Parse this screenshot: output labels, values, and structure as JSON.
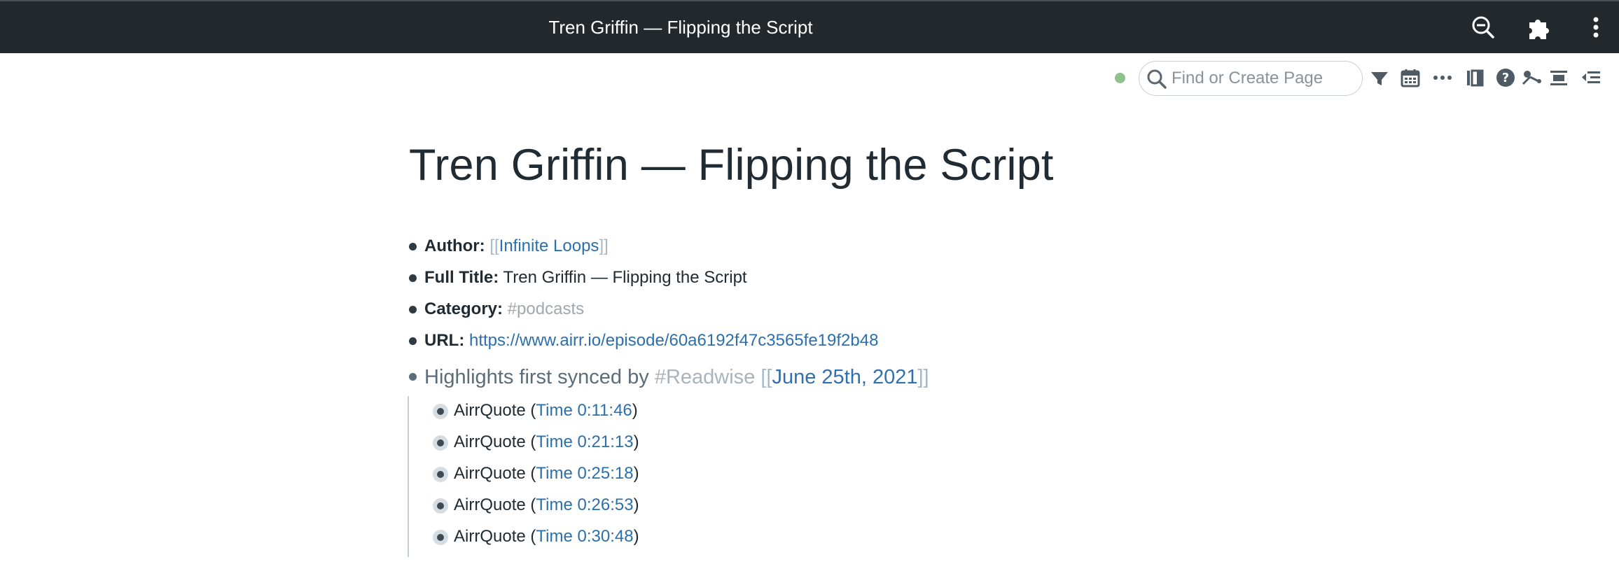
{
  "window": {
    "title": "Tren Griffin — Flipping the Script",
    "icons": [
      "zoom-out-icon",
      "puzzle-icon",
      "more-vertical-icon"
    ]
  },
  "toolbar": {
    "status_color": "#8ec28c",
    "search": {
      "placeholder": "Find or Create Page",
      "value": ""
    },
    "tools": [
      "filter-icon",
      "calendar-icon",
      "more-horizontal-icon",
      "sidebar-icon",
      "help-icon",
      "graph-icon",
      "align-center-icon",
      "outdent-icon"
    ]
  },
  "page": {
    "title": "Tren Griffin — Flipping the Script",
    "fields": {
      "author": {
        "label": "Author:",
        "open": "[[",
        "value": "Infinite Loops",
        "close": "]]"
      },
      "full_title": {
        "label": "Full Title:",
        "value": "Tren Griffin — Flipping the Script"
      },
      "category": {
        "label": "Category:",
        "value": "#podcasts"
      },
      "url": {
        "label": "URL:",
        "value": "https://www.airr.io/episode/60a6192f47c3565fe19f2b48"
      }
    },
    "highlights_header": {
      "text": "Highlights first synced by",
      "tag": "#Readwise",
      "open": "[[",
      "date": "June 25th, 2021",
      "close": "]]"
    },
    "highlights": [
      {
        "prefix": "AirrQuote (",
        "time": "Time 0:11:46",
        "suffix": ")"
      },
      {
        "prefix": "AirrQuote (",
        "time": "Time 0:21:13",
        "suffix": ")"
      },
      {
        "prefix": "AirrQuote (",
        "time": "Time 0:25:18",
        "suffix": ")"
      },
      {
        "prefix": "AirrQuote (",
        "time": "Time 0:26:53",
        "suffix": ")"
      },
      {
        "prefix": "AirrQuote (",
        "time": "Time 0:30:48",
        "suffix": ")"
      }
    ]
  },
  "colors": {
    "titlebar": "#23282d",
    "link": "#2d6fab",
    "tag": "#a0a8ae",
    "text": "#202b33"
  }
}
